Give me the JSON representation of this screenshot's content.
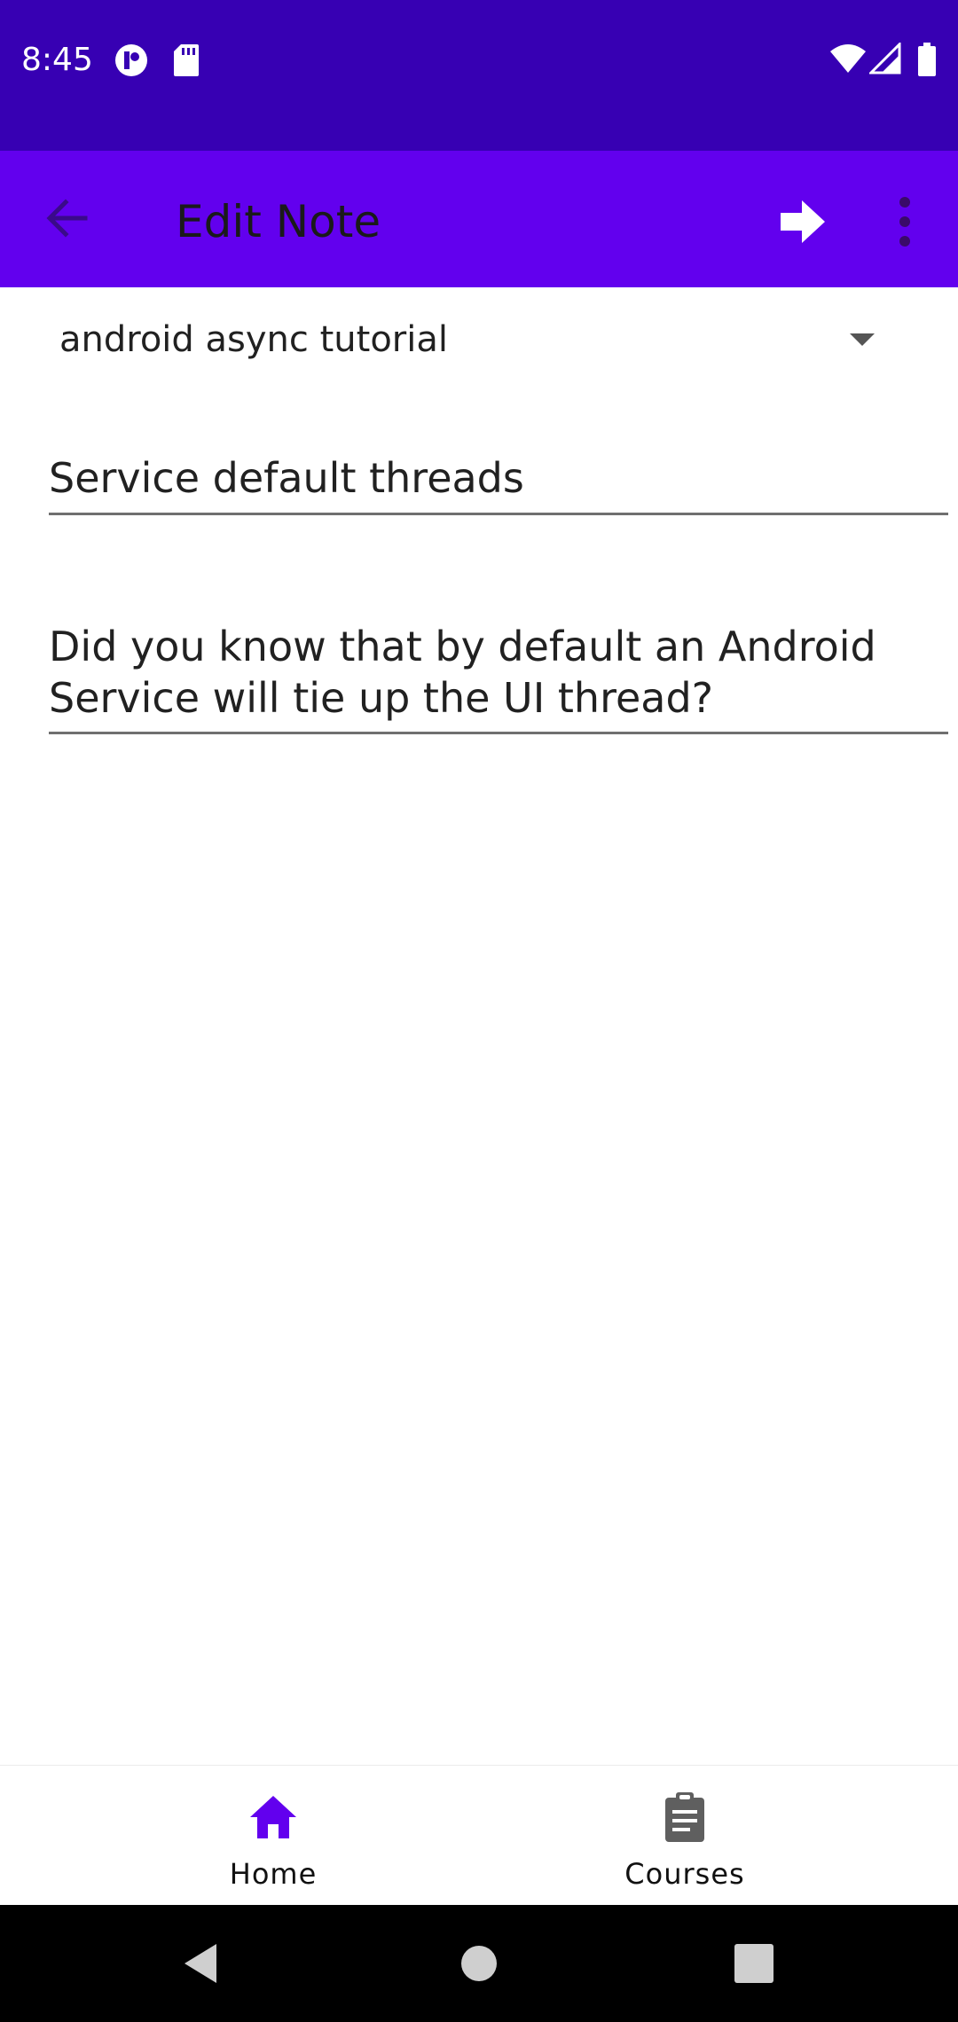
{
  "status_bar": {
    "time": "8:45",
    "icons": [
      "notification-app-icon",
      "sd-card-icon",
      "wifi-icon",
      "cell-signal-icon",
      "battery-icon"
    ]
  },
  "app_bar": {
    "title": "Edit Note",
    "icons": [
      "back-arrow-icon",
      "next-arrow-icon",
      "more-vert-icon"
    ]
  },
  "form": {
    "course_spinner_value": "android async tutorial",
    "note_title_value": "Service default threads",
    "note_text_value": "Did you know that by default an Android Service will tie up the UI thread?"
  },
  "bottom_nav": {
    "items": [
      {
        "label": "Home",
        "icon": "home-icon",
        "selected": true
      },
      {
        "label": "Courses",
        "icon": "clipboard-icon",
        "selected": false
      }
    ]
  },
  "colors": {
    "status_bar": "#3700B3",
    "app_bar": "#6200EE",
    "nav_selected": "#6200EE",
    "nav_unselected": "#5f5f5f"
  }
}
